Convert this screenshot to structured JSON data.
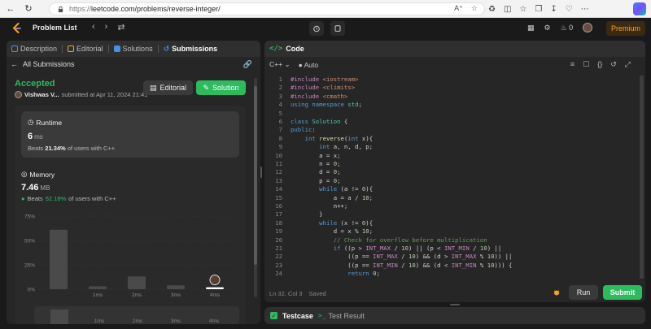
{
  "browser": {
    "url_prefix": "https://",
    "url_rest": "leetcode.com/problems/reverse-integer/"
  },
  "topbar": {
    "problem_list": "Problem List",
    "streak": "0",
    "premium": "Premium"
  },
  "left": {
    "tabs": [
      {
        "label": "Description"
      },
      {
        "label": "Editorial"
      },
      {
        "label": "Solutions"
      },
      {
        "label": "Submissions"
      }
    ],
    "back_label": "All Submissions",
    "status": "Accepted",
    "user": "Vishwas V...",
    "submitted_at": "submitted at Apr 11, 2024 21:41",
    "editorial_btn": "Editorial",
    "solution_btn": "Solution",
    "runtime": {
      "title": "Runtime",
      "value": "6",
      "unit": "ms",
      "beats_prefix": "Beats",
      "beats_pct": "21.34%",
      "beats_suffix": "of users with C++"
    },
    "memory": {
      "title": "Memory",
      "value": "7.46",
      "unit": "MB",
      "beats_prefix": "Beats",
      "beats_pct": "52.18%",
      "beats_suffix": "of users with C++"
    }
  },
  "chart_data": {
    "type": "bar",
    "categories": [
      "",
      "1ms",
      "2ms",
      "3ms",
      "4ms"
    ],
    "values": [
      61,
      3,
      13,
      4,
      2
    ],
    "y_ticks": [
      "75%",
      "50%",
      "25%",
      "0%"
    ],
    "ylim": [
      0,
      75
    ],
    "highlight_index": 4,
    "bar_color": "#4a4a4a",
    "highlight_color": "#ffffff"
  },
  "mini_chart": {
    "categories": [
      "1ms",
      "2ms",
      "3ms",
      "4ms"
    ]
  },
  "right": {
    "code_title": "Code",
    "language": "C++",
    "mode": "Auto",
    "status_pos": "Ln 32, Col 3",
    "status_saved": "Saved",
    "run": "Run",
    "submit": "Submit"
  },
  "code_lines": [
    "#include <iostream>",
    "#include <climits>",
    "#include <cmath>",
    "using namespace std;",
    "",
    "class Solution {",
    "public:",
    "    int reverse(int x){",
    "        int a, n, d, p;",
    "        a = x;",
    "        n = 0;",
    "        d = 0;",
    "        p = 0;",
    "        while (a != 0){",
    "            a = a / 10;",
    "            n++;",
    "        }",
    "        while (x != 0){",
    "            d = x % 10;",
    "            // Check for overflow before multiplication",
    "            if ((p > INT_MAX / 10) || (p < INT_MIN / 10) ||",
    "                ((p == INT_MAX / 10) && (d > INT_MAX % 10)) ||",
    "                ((p == INT_MIN / 10) && (d < INT_MIN % 10))) {",
    "                return 0;"
  ],
  "bottom": {
    "testcase": "Testcase",
    "test_result": "Test Result"
  }
}
